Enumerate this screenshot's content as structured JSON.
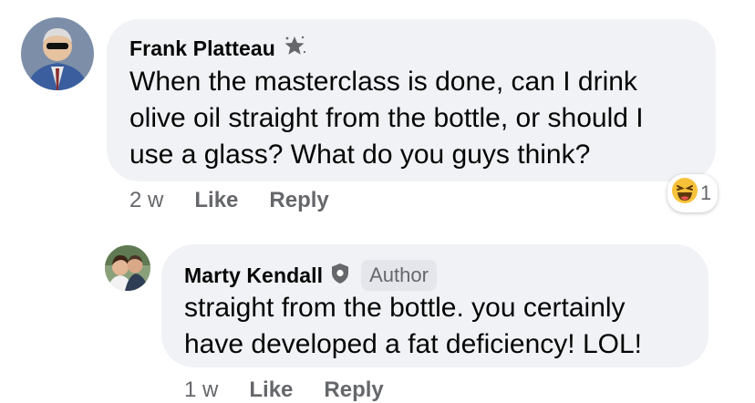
{
  "comments": [
    {
      "author": "Frank Platteau",
      "author_badge_icon": "rising-fan-star-icon",
      "text_lines": [
        "When the masterclass is done, can I drink",
        "olive oil straight from the bottle, or should I",
        "use a glass? What do you guys think?"
      ],
      "time": "2 w",
      "like_label": "Like",
      "reply_label": "Reply",
      "reaction": {
        "icon": "haha-emoji-icon",
        "count": "1"
      }
    },
    {
      "author": "Marty Kendall",
      "author_badge_icon": "shield-icon",
      "author_tag": "Author",
      "text_lines": [
        "straight from the bottle.  you certainly",
        "have developed a fat deficiency!  LOL!"
      ],
      "time": "1 w",
      "like_label": "Like",
      "reply_label": "Reply"
    }
  ],
  "colors": {
    "bubble": "#f0f2f5",
    "meta_text": "#65676b",
    "body_text": "#050505",
    "badge_bg": "#e4e6eb",
    "emoji_yellow": "#f7c23a"
  }
}
